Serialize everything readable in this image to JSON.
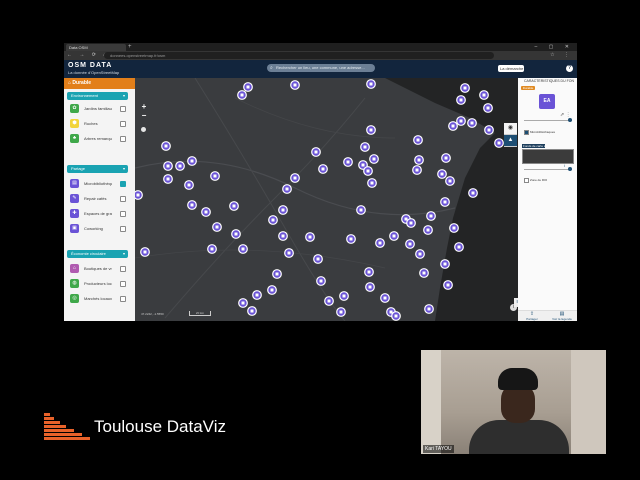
{
  "browser": {
    "tab_title": "Data OSM",
    "url_text": "donnees.openstreetmap.fr/osm",
    "nav_icons": "← → ⟳ ⌂",
    "ext_icons": "☆ ⋮"
  },
  "header": {
    "app_title": "OSM DATA",
    "app_subtitle": "La donnée d'OpenStreetMap",
    "search_placeholder": "Rechercher un lieu, une commune, une adresse...",
    "language_label": "La démarche",
    "help_label": "?"
  },
  "sidebar": {
    "title": "Durable",
    "sections": [
      {
        "label": "Environnement",
        "items": [
          {
            "label": "Jardins familiaux",
            "icon": "garden-icon",
            "color": "#3fa84a",
            "checked": false
          },
          {
            "label": "Ruches",
            "icon": "beehive-icon",
            "color": "#f2d43a",
            "checked": false
          },
          {
            "label": "Arbres remarquables",
            "icon": "tree-icon",
            "color": "#3fa84a",
            "checked": false
          }
        ]
      },
      {
        "label": "Partage",
        "items": [
          {
            "label": "Microbibliothèques",
            "icon": "book-icon",
            "color": "#6a53d6",
            "checked": true
          },
          {
            "label": "Repair cafés",
            "icon": "wrench-icon",
            "color": "#6a53d6",
            "checked": false
          },
          {
            "label": "Espaces de gratuité",
            "icon": "gift-icon",
            "color": "#6a53d6",
            "checked": false
          },
          {
            "label": "Coworking",
            "icon": "desk-icon",
            "color": "#6a53d6",
            "checked": false
          }
        ]
      },
      {
        "label": "Économie circulaire",
        "items": [
          {
            "label": "Boutiques de vrac",
            "icon": "shop-icon",
            "color": "#b05bb0",
            "checked": false
          },
          {
            "label": "Producteurs locaux",
            "icon": "basket-icon",
            "color": "#3fa84a",
            "checked": false
          },
          {
            "label": "Marchés locaux",
            "icon": "market-icon",
            "color": "#3fa84a",
            "checked": false
          }
        ]
      }
    ]
  },
  "map": {
    "zoom_in": "+",
    "zoom_out": "−",
    "coordinates": "47.2242, -1.5550",
    "scale": "20 km",
    "attribution": "i",
    "marker_color": "#6a53d6"
  },
  "right_panel": {
    "title": "CARACTÉRISTIQUES DU FOND DE CARTE",
    "tag": "Durable",
    "avatar_text": "EA",
    "share_icons": "⇗ ⋮",
    "layers": [
      {
        "label": "Microbibliothèques",
        "checked": true
      },
      {
        "label": "Zone de ROI",
        "checked": false
      }
    ],
    "basemap_button": "Fonds de carte sombre",
    "info_icon": "i",
    "bottom_buttons": [
      {
        "label": "Partager",
        "icon": "share-icon",
        "glyph": "⇪"
      },
      {
        "label": "Voir la légende",
        "icon": "legend-icon",
        "glyph": "▤"
      }
    ]
  },
  "webcam": {
    "participant_name": "Kari TAYOU"
  },
  "brand": {
    "name": "Toulouse DataViz",
    "accent": "#e8622a"
  }
}
